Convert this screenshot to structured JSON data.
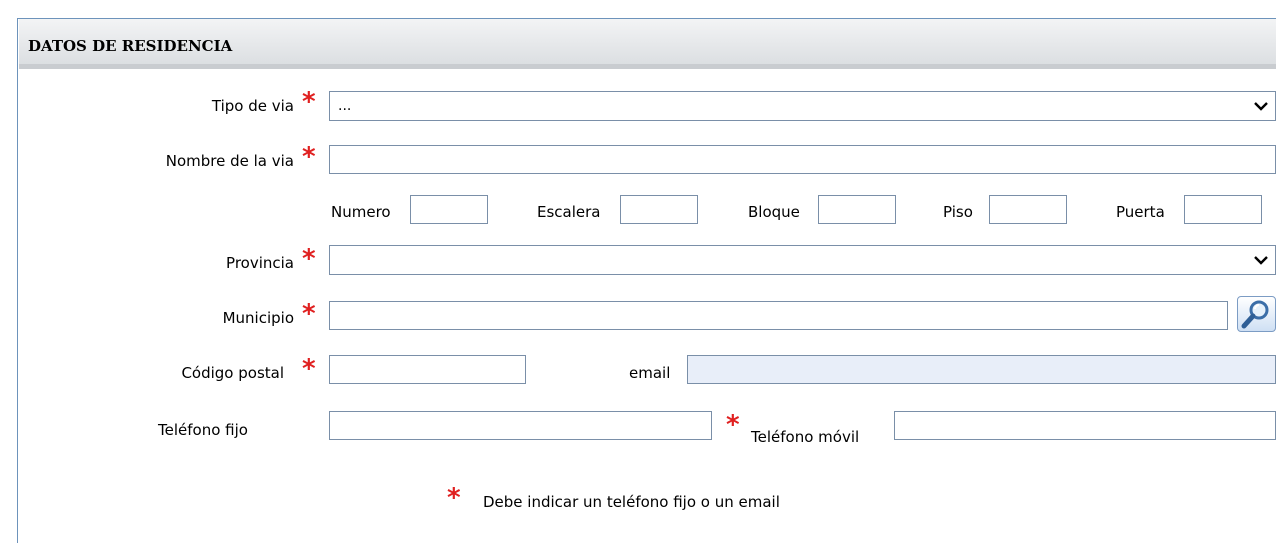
{
  "section": {
    "title": "DATOS DE RESIDENCIA"
  },
  "fields": {
    "tipo_via": {
      "label": "Tipo de via",
      "value": "..."
    },
    "nombre_via": {
      "label": "Nombre de la via",
      "value": ""
    },
    "numero": {
      "label": "Numero",
      "value": ""
    },
    "escalera": {
      "label": "Escalera",
      "value": ""
    },
    "bloque": {
      "label": "Bloque",
      "value": ""
    },
    "piso": {
      "label": "Piso",
      "value": ""
    },
    "puerta": {
      "label": "Puerta",
      "value": ""
    },
    "provincia": {
      "label": "Provincia",
      "value": ""
    },
    "municipio": {
      "label": "Municipio",
      "value": ""
    },
    "codigo_postal": {
      "label": "Código postal",
      "value": ""
    },
    "email": {
      "label": "email",
      "value": ""
    },
    "telefono_fijo": {
      "label": "Teléfono fijo",
      "value": ""
    },
    "telefono_movil": {
      "label": "Teléfono móvil",
      "value": ""
    }
  },
  "required_marker": "*",
  "note": "Debe indicar un teléfono fijo o un email",
  "colors": {
    "required": "#e02020",
    "email_bg": "#e8eef9",
    "border": "#7a8fa8"
  },
  "icons": {
    "dropdown": "chevron-down-icon",
    "lookup": "magnifier-icon"
  }
}
